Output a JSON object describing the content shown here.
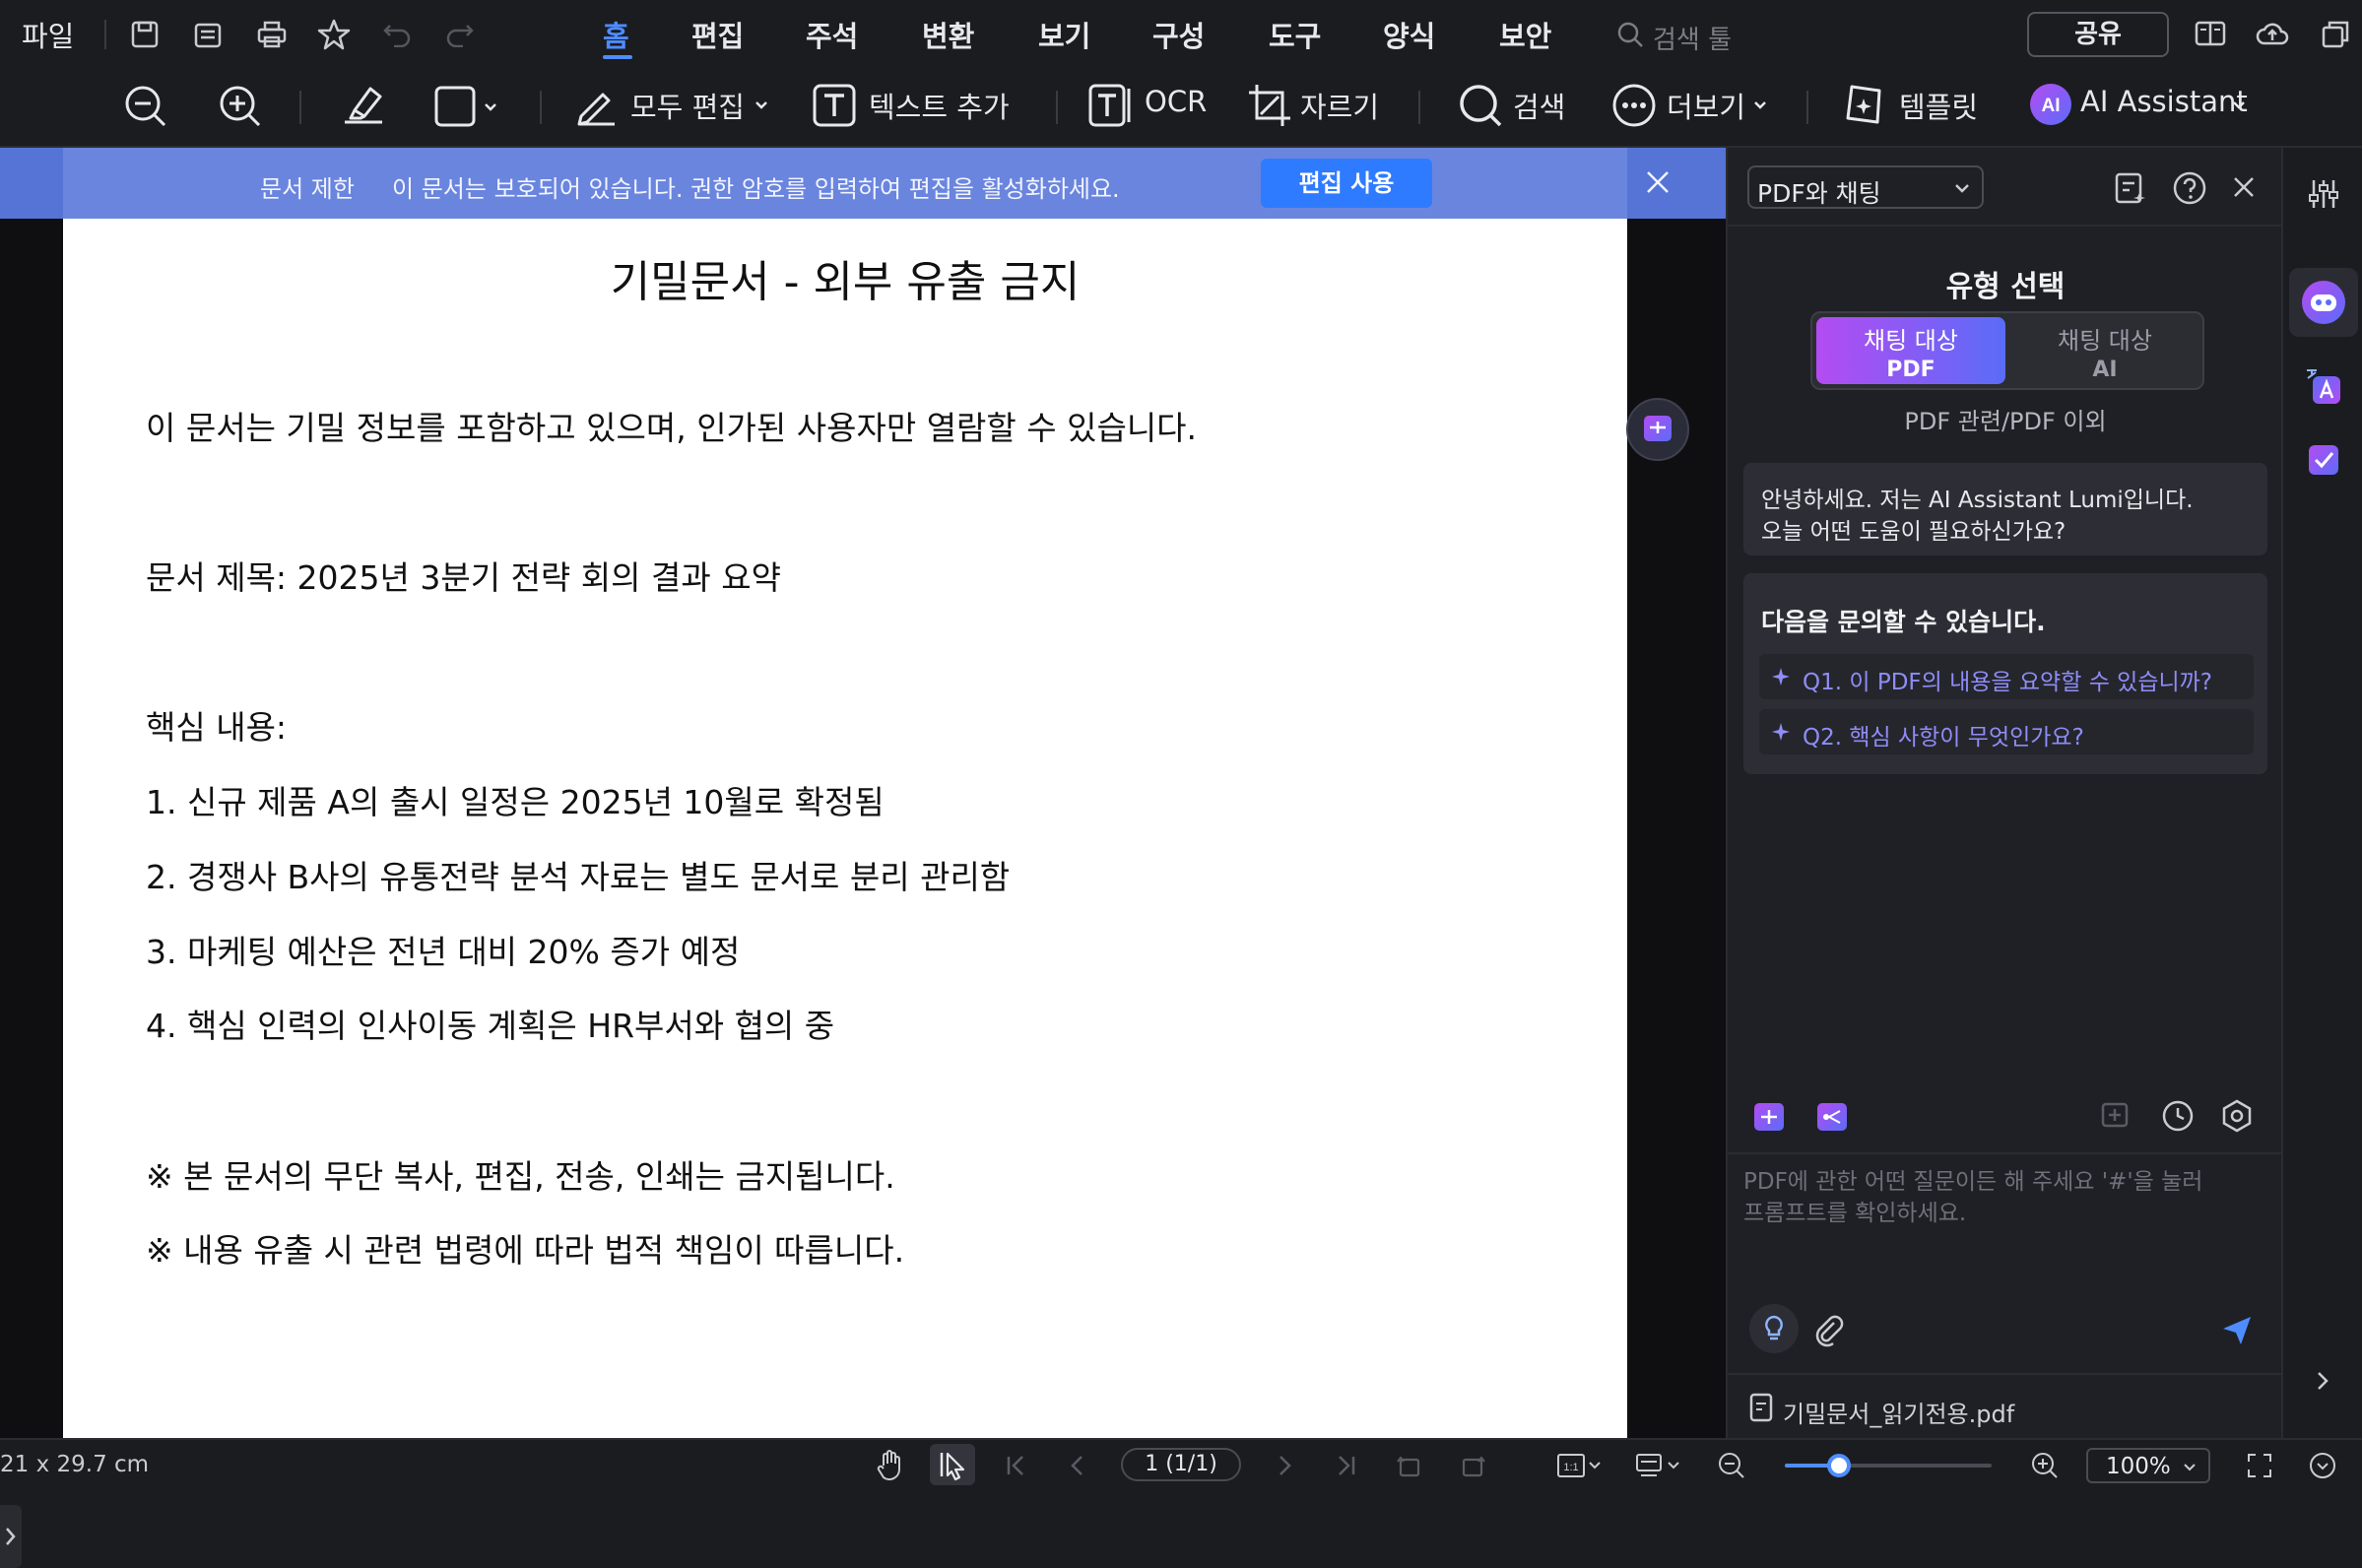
{
  "menubar": {
    "file_label": "파일",
    "tabs": [
      "홈",
      "편집",
      "주석",
      "변환",
      "보기",
      "구성",
      "도구",
      "양식",
      "보안"
    ],
    "active_tab": "홈",
    "search_placeholder": "검색 툴",
    "share_label": "공유",
    "accent_color": "#4f8cff"
  },
  "toolbar": {
    "edit_all_label": "모두 편집",
    "add_text_label": "텍스트 추가",
    "ocr_label": "OCR",
    "crop_label": "자르기",
    "search_label": "검색",
    "more_label": "더보기",
    "template_label": "템플릿",
    "ai_label": "AI Assistant",
    "ai_badge": "AI"
  },
  "banner": {
    "title": "문서 제한",
    "message": "이 문서는 보호되어 있습니다. 권한 암호를 입력하여 편집을 활성화하세요.",
    "button_label": "편집 사용",
    "color": "#6a85de"
  },
  "document": {
    "title": "기밀문서 - 외부 유출 금지",
    "lines": [
      "이 문서는 기밀 정보를 포함하고 있으며, 인가된 사용자만 열람할 수 있습니다.",
      "문서 제목: 2025년 3분기 전략 회의 결과 요약",
      "핵심 내용:",
      "1. 신규 제품 A의 출시 일정은 2025년 10월로 확정됨",
      "2. 경쟁사 B사의 유통전략 분석 자료는 별도 문서로 분리 관리함",
      "3. 마케팅 예산은 전년 대비 20% 증가 예정",
      "4. 핵심 인력의 인사이동 계획은 HR부서와 협의 중",
      "※ 본 문서의 무단 복사, 편집, 전송, 인쇄는 금지됩니다.",
      "※ 내용 유출 시 관련 법령에 따라 법적 책임이 따릅니다."
    ]
  },
  "ai_panel": {
    "mode_select": "PDF와 채팅",
    "type_title": "유형 선택",
    "seg_left": {
      "line1": "채팅 대상",
      "line2": "PDF"
    },
    "seg_right": {
      "line1": "채팅 대상",
      "line2": "AI"
    },
    "seg_caption": "PDF 관련/PDF 이외",
    "greeting": [
      "안녕하세요. 저는 AI Assistant Lumi입니다.",
      "오늘 어떤 도움이 필요하신가요?"
    ],
    "suggest_title": "다음을 문의할 수 있습니다.",
    "questions": [
      "Q1. 이 PDF의 내용을 요약할 수 있습니까?",
      "Q2. 핵심 사항이 무엇인가요?"
    ],
    "input_placeholder": [
      "PDF에 관한 어떤 질문이든 해 주세요 '#'을 눌러",
      "프롬프트를 확인하세요."
    ],
    "file_name": "기밀문서_읽기전용.pdf"
  },
  "statusbar": {
    "page_size": "21 x 29.7 cm",
    "page_indicator": "1 (1/1)",
    "zoom": "100%",
    "zoom_fraction": 0.26
  }
}
